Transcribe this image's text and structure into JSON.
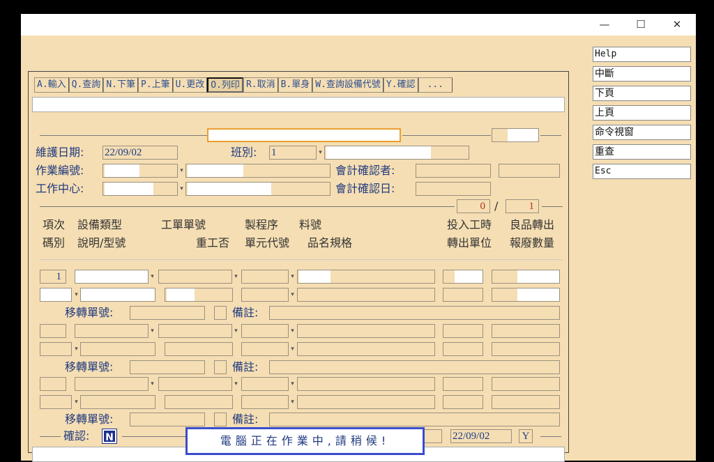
{
  "window": {
    "minimize": "—",
    "maximize": "☐",
    "close": "✕"
  },
  "menu": [
    "A.輸入",
    "Q.查詢",
    "N.下筆",
    "P.上筆",
    "U.更改",
    "O.列印",
    "R.取消",
    "B.單身",
    "W.查詢設備代號",
    "Y.確認",
    "..."
  ],
  "header": {
    "maint_date_label": "維護日期:",
    "maint_date": "22/09/02",
    "shift_label": "班別:",
    "shift": "1",
    "work_no_label": "作業編號:",
    "work_center_label": "工作中心:",
    "acct_confirm_by_label": "會計確認者:",
    "acct_confirm_date_label": "會計確認日:"
  },
  "page": {
    "current": "0",
    "total": "1"
  },
  "columns": {
    "row1": [
      "項次",
      "設備類型",
      "工單單號",
      "製程序",
      "料號",
      "投入工時",
      "良品轉出"
    ],
    "row2": [
      "碼別",
      "說明/型號",
      "重工否",
      "單元代號",
      "品名規格",
      "轉出單位",
      "報廢數量"
    ]
  },
  "detail": {
    "item_no": "1",
    "transfer_label": "移轉單號:",
    "remark_label": "備註:"
  },
  "footer": {
    "confirm_label": "確認:",
    "confirm_value": "N",
    "date": "22/09/02",
    "flag": "Y",
    "status": "電腦正在作業中,請稍候!"
  },
  "sidebar": [
    "Help",
    "中斷",
    "下頁",
    "上頁",
    "命令視窗",
    "重查",
    "Esc"
  ]
}
